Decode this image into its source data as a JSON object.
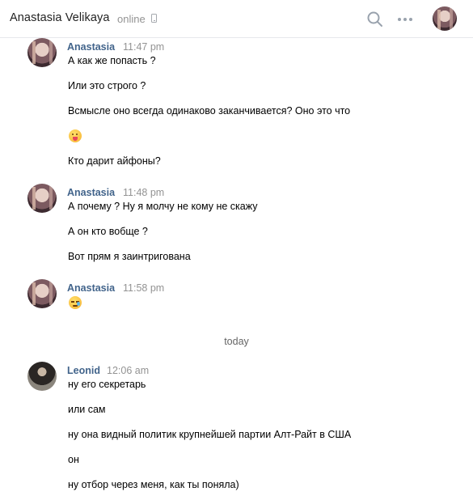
{
  "header": {
    "contact_name": "Anastasia Velikaya",
    "status": "online",
    "icons": [
      "phone-icon",
      "search-icon",
      "more-icon",
      "avatar"
    ]
  },
  "colors": {
    "sender_name": "#42648b",
    "time": "#939393",
    "divider": "#e7e8ec"
  },
  "groups": [
    {
      "sender": "Anastasia",
      "time": "11:47 pm",
      "messages": [
        "А как же попасть ?",
        "Или это строго ?",
        "Всмысле оно всегда одинаково заканчивается? Оно это что",
        "emoji:face-with-tongue",
        "Кто дарит айфоны?"
      ]
    },
    {
      "sender": "Anastasia",
      "time": "11:48 pm",
      "messages": [
        "А почему ? Ну я молчу не кому не скажу",
        "А он кто вобще ?",
        "Вот прям я заинтригована"
      ]
    },
    {
      "sender": "Anastasia",
      "time": "11:58 pm",
      "messages": [
        "emoji:sleepy-face"
      ]
    },
    {
      "sender": "Leonid",
      "time": "12:06 am",
      "messages": [
        "ну его секретарь",
        "или сам",
        "ну она видный политик крупнейшей партии Алт-Райт в США",
        "он",
        "ну отбор через меня, как ты поняла)"
      ]
    }
  ],
  "day_separator": "today"
}
